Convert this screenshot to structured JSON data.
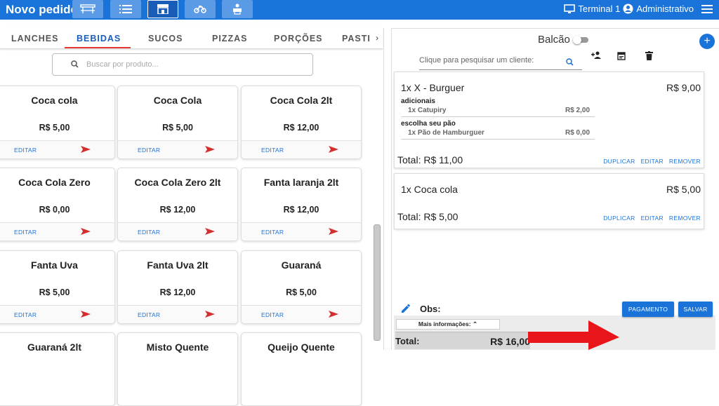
{
  "topbar": {
    "title": "Novo pedido",
    "terminal": "Terminal 1",
    "user": "Administrativo",
    "buttons": [
      "tables-icon",
      "list-icon",
      "store-icon",
      "motorcycle-icon",
      "printer-user-icon"
    ]
  },
  "categories": {
    "tabs": [
      "LANCHES",
      "BEBIDAS",
      "SUCOS",
      "PIZZAS",
      "PORÇÕES",
      "PASTI"
    ],
    "active": "BEBIDAS"
  },
  "search": {
    "placeholder": "Buscar por produto..."
  },
  "products": [
    {
      "name": "Coca cola",
      "price": "R$ 5,00",
      "edit": "EDITAR"
    },
    {
      "name": "Coca Cola",
      "price": "R$ 5,00",
      "edit": "EDITAR"
    },
    {
      "name": "Coca Cola 2lt",
      "price": "R$ 12,00",
      "edit": "EDITAR"
    },
    {
      "name": "Coca Cola Zero",
      "price": "R$ 0,00",
      "edit": "EDITAR"
    },
    {
      "name": "Coca Cola Zero 2lt",
      "price": "R$ 12,00",
      "edit": "EDITAR"
    },
    {
      "name": "Fanta laranja 2lt",
      "price": "R$ 12,00",
      "edit": "EDITAR"
    },
    {
      "name": "Fanta Uva",
      "price": "R$ 5,00",
      "edit": "EDITAR"
    },
    {
      "name": "Fanta Uva 2lt",
      "price": "R$ 12,00",
      "edit": "EDITAR"
    },
    {
      "name": "Guaraná",
      "price": "R$ 5,00",
      "edit": "EDITAR"
    },
    {
      "name": "Guaraná 2lt",
      "price": "",
      "edit": ""
    },
    {
      "name": "Misto Quente",
      "price": "",
      "edit": ""
    },
    {
      "name": "Queijo Quente",
      "price": "",
      "edit": ""
    }
  ],
  "order": {
    "mode_label": "Balcão",
    "client_placeholder": "Clique para pesquisar um cliente:",
    "items": [
      {
        "name": "1x X - Burguer",
        "price": "R$ 9,00",
        "groups": [
          {
            "title": "adicionais",
            "option": "1x Catupiry",
            "option_price": "R$ 2,00"
          },
          {
            "title": "escolha seu pão",
            "option": "1x Pão de Hamburguer",
            "option_price": "R$ 0,00"
          }
        ],
        "total": "Total: R$ 11,00"
      },
      {
        "name": "1x Coca cola",
        "price": "R$ 5,00",
        "groups": [],
        "total": "Total: R$ 5,00"
      }
    ],
    "actions": {
      "duplicate": "DUPLICAR",
      "edit": "EDITAR",
      "remove": "REMOVER"
    },
    "obs_label": "Obs:",
    "more_info": "Mais informações:",
    "total_label": "Total:",
    "total_value": "R$ 16,00",
    "pay_button": "PAGAMENTO",
    "save_button": "SALVAR"
  },
  "colors": {
    "primary": "#1a73d9",
    "accent_red": "#e53935",
    "arrow_red": "#e8151b"
  }
}
